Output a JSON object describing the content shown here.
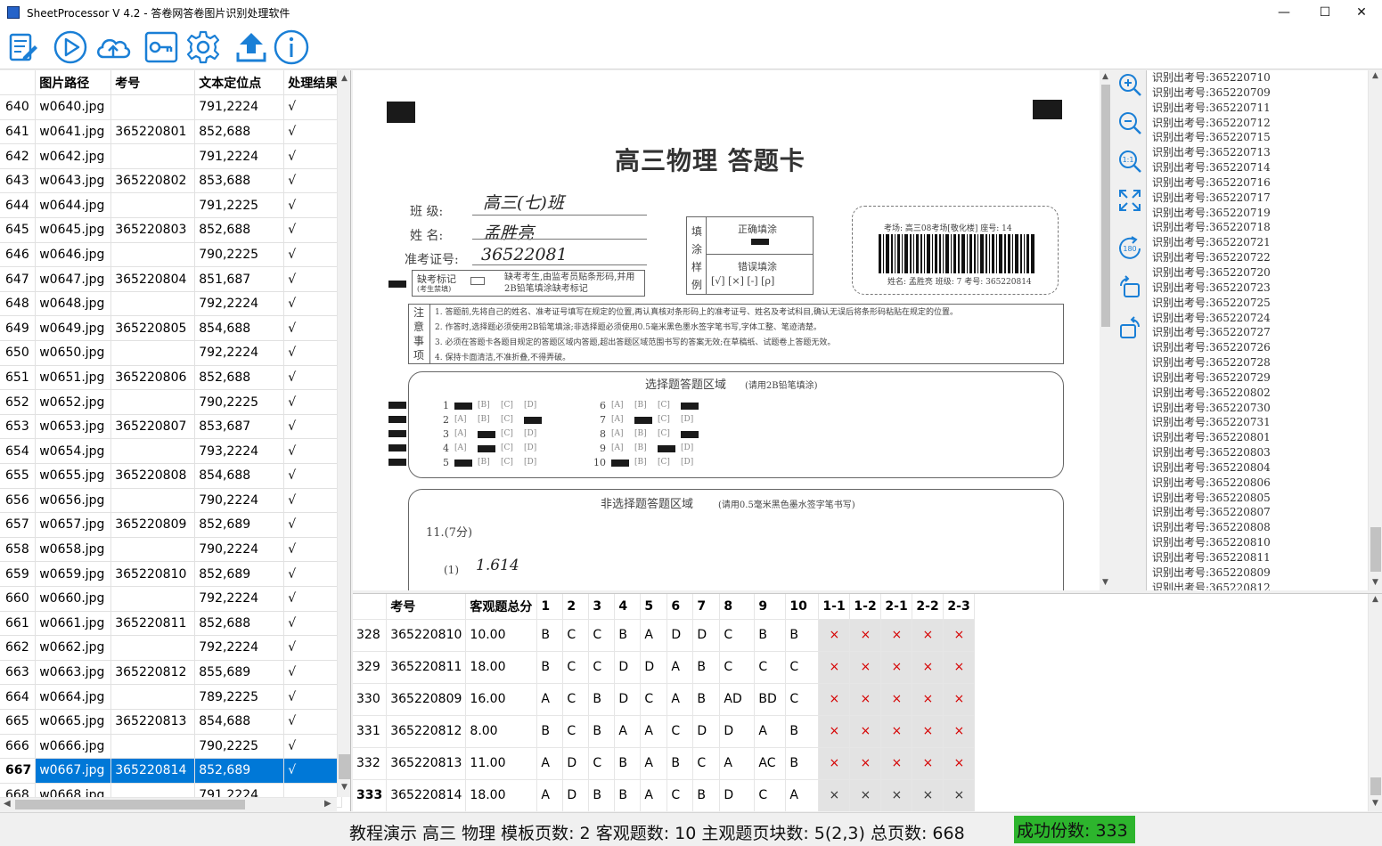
{
  "app": {
    "title": "SheetProcessor V 4.2 - 答卷网答卷图片识别处理软件",
    "minimize": "—",
    "maximize": "☐",
    "close": "✕"
  },
  "toolbar": {
    "buttons": [
      "edit-template-icon",
      "play-icon",
      "cloud-upload-icon",
      "key-icon",
      "gear-icon",
      "upload-icon",
      "info-icon"
    ],
    "accent": "#1a7fd6"
  },
  "file_table": {
    "headers": [
      "",
      "图片路径",
      "考号",
      "文本定位点",
      "处理结果"
    ],
    "rows": [
      [
        "640",
        "w0640.jpg",
        "",
        "791,2224",
        "√"
      ],
      [
        "641",
        "w0641.jpg",
        "365220801",
        "852,688",
        "√"
      ],
      [
        "642",
        "w0642.jpg",
        "",
        "791,2224",
        "√"
      ],
      [
        "643",
        "w0643.jpg",
        "365220802",
        "853,688",
        "√"
      ],
      [
        "644",
        "w0644.jpg",
        "",
        "791,2225",
        "√"
      ],
      [
        "645",
        "w0645.jpg",
        "365220803",
        "852,688",
        "√"
      ],
      [
        "646",
        "w0646.jpg",
        "",
        "790,2225",
        "√"
      ],
      [
        "647",
        "w0647.jpg",
        "365220804",
        "851,687",
        "√"
      ],
      [
        "648",
        "w0648.jpg",
        "",
        "792,2224",
        "√"
      ],
      [
        "649",
        "w0649.jpg",
        "365220805",
        "854,688",
        "√"
      ],
      [
        "650",
        "w0650.jpg",
        "",
        "792,2224",
        "√"
      ],
      [
        "651",
        "w0651.jpg",
        "365220806",
        "852,688",
        "√"
      ],
      [
        "652",
        "w0652.jpg",
        "",
        "790,2225",
        "√"
      ],
      [
        "653",
        "w0653.jpg",
        "365220807",
        "853,687",
        "√"
      ],
      [
        "654",
        "w0654.jpg",
        "",
        "793,2224",
        "√"
      ],
      [
        "655",
        "w0655.jpg",
        "365220808",
        "854,688",
        "√"
      ],
      [
        "656",
        "w0656.jpg",
        "",
        "790,2224",
        "√"
      ],
      [
        "657",
        "w0657.jpg",
        "365220809",
        "852,689",
        "√"
      ],
      [
        "658",
        "w0658.jpg",
        "",
        "790,2224",
        "√"
      ],
      [
        "659",
        "w0659.jpg",
        "365220810",
        "852,689",
        "√"
      ],
      [
        "660",
        "w0660.jpg",
        "",
        "792,2224",
        "√"
      ],
      [
        "661",
        "w0661.jpg",
        "365220811",
        "852,688",
        "√"
      ],
      [
        "662",
        "w0662.jpg",
        "",
        "792,2224",
        "√"
      ],
      [
        "663",
        "w0663.jpg",
        "365220812",
        "855,689",
        "√"
      ],
      [
        "664",
        "w0664.jpg",
        "",
        "789,2225",
        "√"
      ],
      [
        "665",
        "w0665.jpg",
        "365220813",
        "854,688",
        "√"
      ],
      [
        "666",
        "w0666.jpg",
        "",
        "790,2225",
        "√"
      ],
      [
        "667",
        "w0667.jpg",
        "365220814",
        "852,689",
        "√"
      ],
      [
        "668",
        "w0668.jpg",
        "",
        "791,2224",
        ""
      ]
    ],
    "selected_row": "667",
    "selection_color": "#0078d7"
  },
  "sheet": {
    "title": "高三物理  答题卡",
    "class_label": "班  级:",
    "class_value": "高三(七)班",
    "name_label": "姓  名:",
    "name_value": "孟胜亮",
    "exam_no_label": "准考证号:",
    "exam_no_value": "36522081",
    "absent_label": "缺考标记",
    "absent_note": "(考生禁填)",
    "absent_desc": "缺考考生,由监考员贴条形码,并用2B铅笔填涂缺考标记",
    "fill_label": [
      "填",
      "涂",
      "样",
      "例"
    ],
    "fill_correct": "正确填涂",
    "fill_wrong": "错误填涂",
    "fill_wrong_examples": "[√]  [×]  [-]  [ρ]",
    "barcode_text": "考场: 高三08考场[敬化楼]   座号: 14",
    "barcode_footer": "姓名: 孟胜亮  班级: 7  考号: 365220814",
    "notes_label": [
      "注",
      "意",
      "事",
      "项"
    ],
    "notes": [
      "1. 答题前,先将自己的姓名、准考证号填写在规定的位置,再认真核对条形码上的准考证号、姓名及考试科目,确认无误后将条形码粘贴在规定的位置。",
      "2. 作答时,选择题必须使用2B铅笔填涂;非选择题必须使用0.5毫米黑色墨水签字笔书写,字体工整、笔迹清楚。",
      "3. 必须在答题卡各题目规定的答题区域内答题,超出答题区域范围书写的答案无效;在草稿纸、试题卷上答题无效。",
      "4. 保持卡面清洁,不准折叠,不得弄破。"
    ],
    "mcq_title": "选择题答题区域",
    "mcq_note": "(请用2B铅笔填涂)",
    "mcq_numbers": [
      "1",
      "2",
      "3",
      "4",
      "5",
      "6",
      "7",
      "8",
      "9",
      "10"
    ],
    "mcq_options": [
      "[A]",
      "[B]",
      "[C]",
      "[D]"
    ],
    "nonmcq_title": "非选择题答题区域",
    "nonmcq_note": "(请用0.5毫米黑色墨水签字笔书写)",
    "q11_label": "11.(7分)",
    "q11_sub": "(1)",
    "q11_answer": "1.614"
  },
  "zoom_tools": [
    "zoom-in-icon",
    "zoom-out-icon",
    "actual-size-icon",
    "fit-icon",
    "rotate-180-icon",
    "rotate-cw-icon",
    "rotate-ccw-icon"
  ],
  "log": {
    "lines": [
      "识别出考号:365220710",
      "识别出考号:365220709",
      "识别出考号:365220711",
      "识别出考号:365220712",
      "识别出考号:365220715",
      "识别出考号:365220713",
      "识别出考号:365220714",
      "识别出考号:365220716",
      "识别出考号:365220717",
      "识别出考号:365220719",
      "识别出考号:365220718",
      "识别出考号:365220721",
      "识别出考号:365220722",
      "识别出考号:365220720",
      "识别出考号:365220723",
      "识别出考号:365220725",
      "识别出考号:365220724",
      "识别出考号:365220727",
      "识别出考号:365220726",
      "识别出考号:365220728",
      "识别出考号:365220729",
      "识别出考号:365220802",
      "识别出考号:365220730",
      "识别出考号:365220731",
      "识别出考号:365220801",
      "识别出考号:365220803",
      "识别出考号:365220804",
      "识别出考号:365220806",
      "识别出考号:365220805",
      "识别出考号:365220807",
      "识别出考号:365220808",
      "识别出考号:365220810",
      "识别出考号:365220811",
      "识别出考号:365220809",
      "识别出考号:365220812"
    ]
  },
  "results_table": {
    "headers": [
      "",
      "考号",
      "客观题总分",
      "1",
      "2",
      "3",
      "4",
      "5",
      "6",
      "7",
      "8",
      "9",
      "10",
      "1-1",
      "1-2",
      "2-1",
      "2-2",
      "2-3"
    ],
    "rows": [
      [
        "328",
        "365220810",
        "10.00",
        "B",
        "C",
        "C",
        "B",
        "A",
        "D",
        "D",
        "C",
        "B",
        "B",
        "×",
        "×",
        "×",
        "×",
        "×"
      ],
      [
        "329",
        "365220811",
        "18.00",
        "B",
        "C",
        "C",
        "D",
        "D",
        "A",
        "B",
        "C",
        "C",
        "C",
        "×",
        "×",
        "×",
        "×",
        "×"
      ],
      [
        "330",
        "365220809",
        "16.00",
        "A",
        "C",
        "B",
        "D",
        "C",
        "A",
        "B",
        "AD",
        "BD",
        "C",
        "×",
        "×",
        "×",
        "×",
        "×"
      ],
      [
        "331",
        "365220812",
        "8.00",
        "B",
        "C",
        "B",
        "A",
        "A",
        "C",
        "D",
        "D",
        "A",
        "B",
        "×",
        "×",
        "×",
        "×",
        "×"
      ],
      [
        "332",
        "365220813",
        "11.00",
        "A",
        "D",
        "C",
        "B",
        "A",
        "B",
        "C",
        "A",
        "AC",
        "B",
        "×",
        "×",
        "×",
        "×",
        "×"
      ],
      [
        "333",
        "365220814",
        "18.00",
        "A",
        "D",
        "B",
        "B",
        "A",
        "C",
        "B",
        "D",
        "C",
        "A",
        "×",
        "×",
        "×",
        "×",
        "×"
      ]
    ],
    "current_row": "333",
    "mark_color": "#d60000"
  },
  "status": {
    "info": "教程演示  高三  物理  模板页数: 2 客观题数: 10 主观题页块数: 5(2,3)  总页数: 668",
    "success": "成功份数: 333",
    "success_color": "#2db52d"
  }
}
